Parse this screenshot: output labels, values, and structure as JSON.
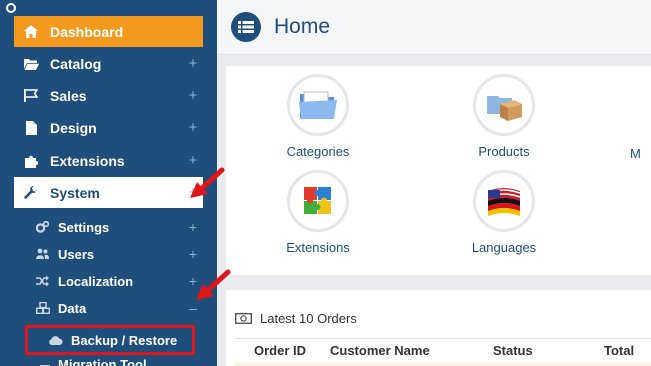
{
  "sidebar": {
    "menu": [
      {
        "label": "Dashboard",
        "icon": "home-icon"
      },
      {
        "label": "Catalog",
        "icon": "folder-icon",
        "expand": "+"
      },
      {
        "label": "Sales",
        "icon": "flag-icon",
        "expand": "+"
      },
      {
        "label": "Design",
        "icon": "document-icon",
        "expand": "+"
      },
      {
        "label": "Extensions",
        "icon": "puzzle-icon",
        "expand": "+"
      },
      {
        "label": "System",
        "icon": "wrench-icon",
        "expand": "+"
      }
    ],
    "submenu": [
      {
        "label": "Settings",
        "icon": "cogs-icon",
        "expand": "+"
      },
      {
        "label": "Users",
        "icon": "users-icon",
        "expand": "+"
      },
      {
        "label": "Localization",
        "icon": "random-icon",
        "expand": "+"
      },
      {
        "label": "Data",
        "icon": "cubes-icon",
        "expand": "–"
      }
    ],
    "data_children": [
      {
        "label": "Backup / Restore",
        "icon": "cloud-icon"
      },
      {
        "label": "Migration Tool"
      }
    ]
  },
  "header": {
    "title": "Home",
    "icon": "list-icon"
  },
  "shortcuts": [
    {
      "label": "Categories",
      "icon": "folder-icon"
    },
    {
      "label": "Products",
      "icon": "box-icon"
    },
    {
      "label": "M",
      "icon": ""
    },
    {
      "label": "Extensions",
      "icon": "puzzle-icon"
    },
    {
      "label": "Languages",
      "icon": "flag-icon"
    }
  ],
  "orders": {
    "title": "Latest 10 Orders",
    "icon": "money-icon",
    "columns": [
      "Order ID",
      "Customer Name",
      "Status",
      "Total"
    ]
  },
  "colors": {
    "sidebar": "#1f4e7a",
    "active": "#f39a1e",
    "annotation": "#e0141b"
  }
}
